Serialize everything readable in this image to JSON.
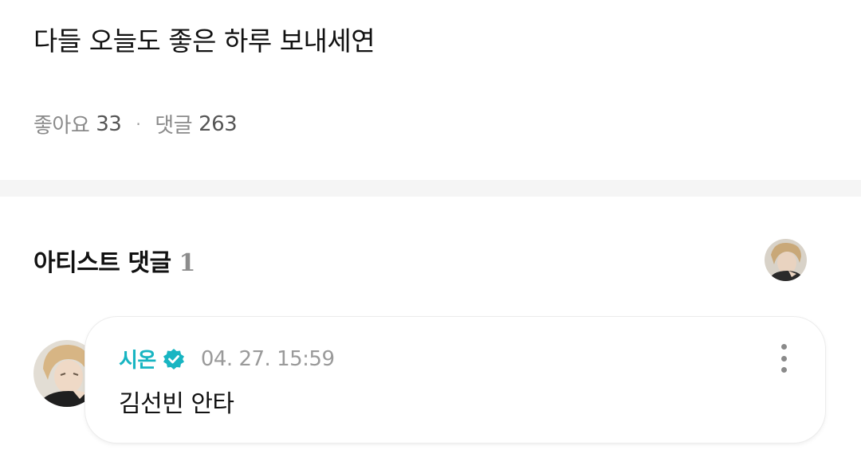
{
  "post": {
    "text": "다들 오늘도 좋은 하루 보내세연",
    "likes_label": "좋아요",
    "likes_count": "33",
    "separator": "·",
    "comments_label": "댓글",
    "comments_count": "263"
  },
  "artist_comments": {
    "title": "아티스트 댓글",
    "count": "1",
    "comments": [
      {
        "author": "시온",
        "verified_icon": "verified-check-icon",
        "timestamp": "04. 27. 15:59",
        "text": "김선빈 안타",
        "more_icon": "more-vertical-icon"
      }
    ]
  },
  "colors": {
    "author": "#18b5c2",
    "verified": "#18b5c2",
    "muted": "#8a8a8a",
    "divider": "#f5f5f5"
  }
}
